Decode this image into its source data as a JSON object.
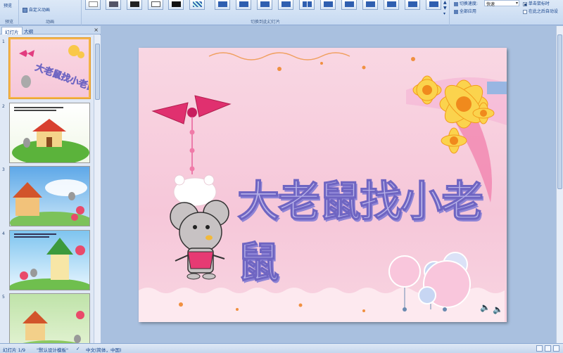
{
  "ribbon": {
    "preview_group_label": "预览",
    "custom_animation_label": "自定义动画",
    "animation_group_label": "动画",
    "transition_group_label": "切换到此幻灯片",
    "transition_speed_label": "切换速度:",
    "transition_speed_value": "快速",
    "apply_all_label": "全部应用",
    "on_click_label": "单击鼠标时",
    "auto_after_label": "在此之后自动设"
  },
  "panel": {
    "tab_slides": "幻灯片",
    "tab_outline": "大纲",
    "close": "×",
    "slide_numbers": [
      "1",
      "2",
      "3",
      "4",
      "5"
    ]
  },
  "slide": {
    "title": "大老鼠找小老鼠"
  },
  "status": {
    "slide_counter": "幻灯片 1/9",
    "theme": "\"默认设计模板\"",
    "language": "中文(简体，中国)"
  },
  "colors": {
    "ribbon_bg": "#c6d9f1",
    "slide_bg": "#f6c7d9",
    "title_fill": "#b9b3e8",
    "title_outline": "#6f65c2",
    "selected_thumb_border": "#f5b54a"
  }
}
